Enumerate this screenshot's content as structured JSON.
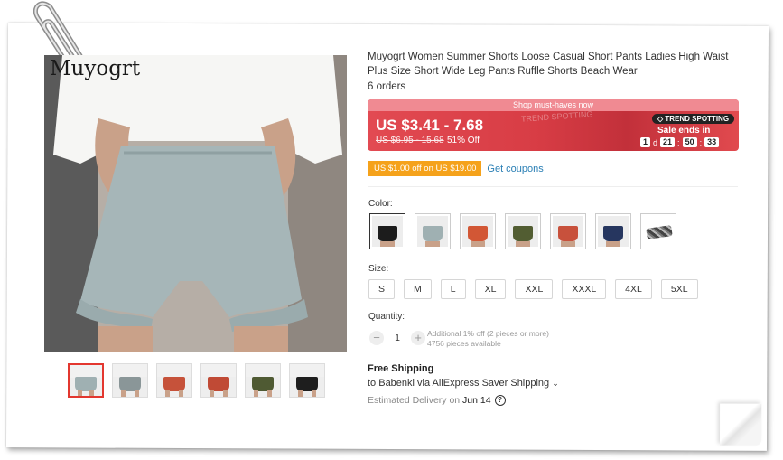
{
  "product": {
    "brand_logo": "Muyogrt",
    "title": "Muyogrt Women Summer Shorts Loose Casual Short Pants Ladies High Waist Plus Size Short Wide Leg Pants Ruffle Shorts Beach Wear",
    "orders": "6 orders"
  },
  "gallery": {
    "thumbs": [
      {
        "color": "#9fb0b2",
        "active": true
      },
      {
        "color": "#8a9698",
        "active": false
      },
      {
        "color": "#c6523a",
        "active": false
      },
      {
        "color": "#c04a35",
        "active": false
      },
      {
        "color": "#4f5a33",
        "active": false
      },
      {
        "color": "#1e1e1e",
        "active": false
      }
    ]
  },
  "price": {
    "banner_top": "Shop must-haves now",
    "range": "US $3.41 - 7.68",
    "original": "US $6.95 - 15.68",
    "discount": "51% Off",
    "trend_badge": "TREND SPOTTING",
    "trend_watermark": "TREND SPOTTING",
    "sale_ends": "Sale ends in",
    "countdown": {
      "days": "1",
      "day_label": "d",
      "hours": "21",
      "minutes": "50",
      "seconds": "33"
    }
  },
  "coupon": {
    "tag": "US $1.00 off on US $19.00",
    "link": "Get coupons"
  },
  "color": {
    "label": "Color:",
    "swatches": [
      {
        "color": "#1c1c1c"
      },
      {
        "color": "#9fb0b2"
      },
      {
        "color": "#d25735"
      },
      {
        "color": "#525d32"
      },
      {
        "color": "#c8513c"
      },
      {
        "color": "#26365f"
      },
      {
        "color": "headband"
      }
    ]
  },
  "size": {
    "label": "Size:",
    "options": [
      "S",
      "M",
      "L",
      "XL",
      "XXL",
      "XXXL",
      "4XL",
      "5XL"
    ]
  },
  "quantity": {
    "label": "Quantity:",
    "value": "1",
    "minus": "−",
    "plus": "+",
    "additional": "Additional 1% off (2 pieces or more)",
    "available": "4756 pieces available"
  },
  "shipping": {
    "title": "Free Shipping",
    "via": "to Babenki via AliExpress Saver Shipping",
    "delivery_prefix": "Estimated Delivery on",
    "delivery_date": "Jun 14"
  }
}
